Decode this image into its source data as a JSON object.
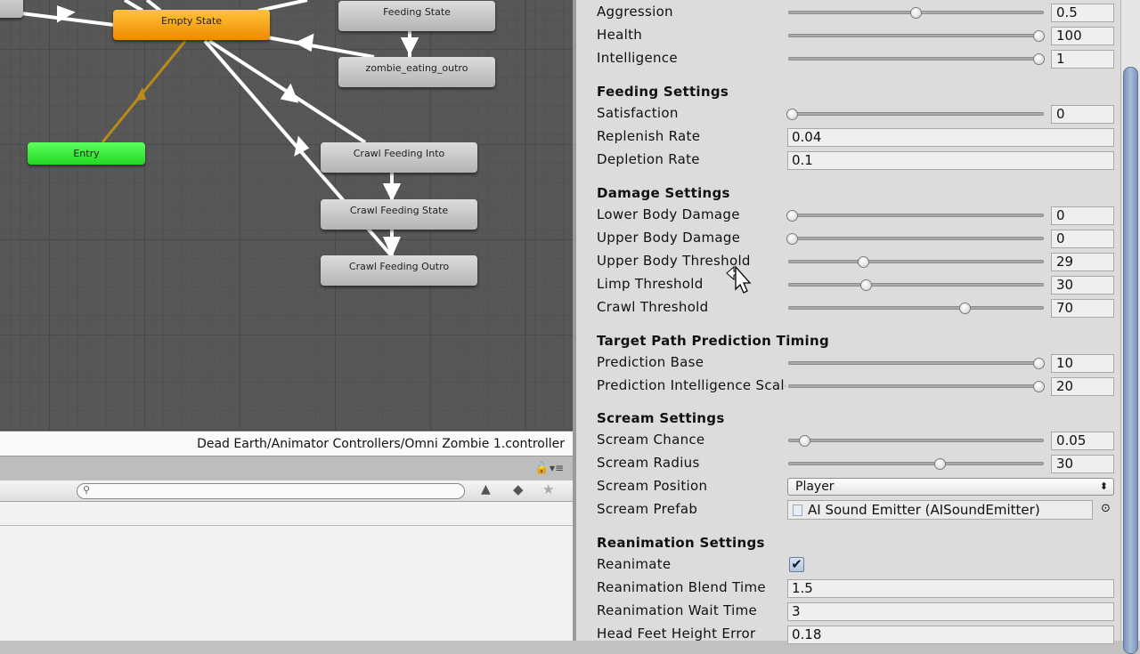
{
  "animator": {
    "nodes": {
      "empty_state": "Empty State",
      "feeding_state": "Feeding State",
      "zombie_eating_outro": "zombie_eating_outro",
      "entry": "Entry",
      "crawl_feeding_into": "Crawl Feeding Into",
      "crawl_feeding_state": "Crawl Feeding State",
      "crawl_feeding_outro": "Crawl Feeding Outro"
    },
    "colors": {
      "default_state": "#f7a21b",
      "entry": "#3de83d",
      "state": "#c8c8c8",
      "entry_transition": "#b98a16"
    },
    "path": "Dead Earth/Animator Controllers/Omni Zombie 1.controller"
  },
  "project": {
    "search_placeholder": "",
    "icons": [
      "lock-icon",
      "menu-icon",
      "filter-by-type-icon",
      "filter-by-label-icon",
      "favorites-star-icon"
    ]
  },
  "inspector": {
    "rows": [
      {
        "type": "slider",
        "label": "Aggression",
        "value": "0.5",
        "fraction": 0.5
      },
      {
        "type": "slider",
        "label": "Health",
        "value": "100",
        "fraction": 1.0
      },
      {
        "type": "slider",
        "label": "Intelligence",
        "value": "1",
        "fraction": 1.0
      },
      {
        "type": "header",
        "label": "Feeding Settings"
      },
      {
        "type": "slider",
        "label": "Satisfaction",
        "value": "0",
        "fraction": 0
      },
      {
        "type": "text",
        "label": "Replenish Rate",
        "value": "0.04"
      },
      {
        "type": "text",
        "label": "Depletion Rate",
        "value": "0.1"
      },
      {
        "type": "header",
        "label": "Damage Settings"
      },
      {
        "type": "slider",
        "label": "Lower Body Damage",
        "value": "0",
        "fraction": 0
      },
      {
        "type": "slider",
        "label": "Upper Body Damage",
        "value": "0",
        "fraction": 0
      },
      {
        "type": "slider",
        "label": "Upper Body Threshold",
        "value": "29",
        "fraction": 0.29
      },
      {
        "type": "slider",
        "label": "Limp Threshold",
        "value": "30",
        "fraction": 0.3
      },
      {
        "type": "slider",
        "label": "Crawl Threshold",
        "value": "70",
        "fraction": 0.7
      },
      {
        "type": "header",
        "label": "Target Path Prediction Timing"
      },
      {
        "type": "slider",
        "label": "Prediction Base",
        "value": "10",
        "fraction": 1.0
      },
      {
        "type": "slider",
        "label": "Prediction Intelligence Scale",
        "value": "20",
        "fraction": 1.0
      },
      {
        "type": "header",
        "label": "Scream Settings"
      },
      {
        "type": "slider",
        "label": "Scream Chance",
        "value": "0.05",
        "fraction": 0.05
      },
      {
        "type": "slider",
        "label": "Scream Radius",
        "value": "30",
        "fraction": 0.6
      },
      {
        "type": "select",
        "label": "Scream Position",
        "value": "Player"
      },
      {
        "type": "object",
        "label": "Scream Prefab",
        "value": "AI Sound Emitter (AISoundEmitter)"
      },
      {
        "type": "header",
        "label": "Reanimation Settings"
      },
      {
        "type": "checkbox",
        "label": "Reanimate",
        "checked": true
      },
      {
        "type": "text",
        "label": "Reanimation Blend Time",
        "value": "1.5"
      },
      {
        "type": "text",
        "label": "Reanimation Wait Time",
        "value": "3"
      },
      {
        "type": "text",
        "label": "Head Feet Height Error",
        "value": "0.18"
      }
    ]
  }
}
